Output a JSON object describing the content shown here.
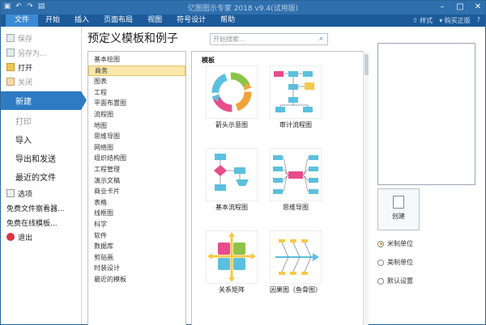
{
  "titlebar": {
    "title": "亿图图示专家 2018 v9.4(试用版)",
    "minimize": "–",
    "maximize": "□",
    "close": "✕"
  },
  "quick_access": {
    "icons": [
      "save-icon",
      "undo-icon",
      "redo-icon",
      "print-icon"
    ]
  },
  "menubar": {
    "tabs": [
      "文件",
      "开始",
      "插入",
      "页面布局",
      "视图",
      "符号设计",
      "帮助"
    ],
    "active_index": 0,
    "style_label": "样式",
    "purchase_label": "购买正版"
  },
  "sidebar": {
    "save": "保存",
    "save_as": "另存为...",
    "open": "打开",
    "close": "关闭",
    "new": "新建",
    "print": "打印",
    "import": "导入",
    "export_send": "导出和发送",
    "recent_files": "最近的文件",
    "options": "选项",
    "free_viewer": "免费文件察看器...",
    "free_templates": "免费在线模板...",
    "exit": "退出"
  },
  "main": {
    "heading": "预定义模板和例子",
    "search_placeholder": "开始搜索..."
  },
  "categories": {
    "items": [
      "基本绘图",
      "商务",
      "图表",
      "工程",
      "平面布置图",
      "流程图",
      "地图",
      "思维导图",
      "网络图",
      "组织结构图",
      "工程管理",
      "演示文稿",
      "商业卡片",
      "表格",
      "线框图",
      "科学",
      "软件",
      "数据库",
      "剪贴画",
      "时装设计",
      "最近的模板"
    ],
    "selected_index": 1
  },
  "templates": {
    "section_title": "模板",
    "items": [
      {
        "label": "箭头示意图",
        "icon": "circular-arrows-icon"
      },
      {
        "label": "审计流程图",
        "icon": "audit-flowchart-icon"
      },
      {
        "label": "基本流程图",
        "icon": "basic-flowchart-icon"
      },
      {
        "label": "思维导图",
        "icon": "mindmap-icon"
      },
      {
        "label": "关系矩阵",
        "icon": "matrix-icon"
      },
      {
        "label": "因果图（鱼骨图）",
        "icon": "fishbone-icon"
      }
    ]
  },
  "right_panel": {
    "create_label": "创建",
    "units": [
      "米制单位",
      "美制单位",
      "默认设置"
    ],
    "selected_unit": 0
  },
  "colors": {
    "accent": "#2f6fae",
    "menubar": "#1c5a9a",
    "active_blue": "#2e7bc3",
    "selection": "#fbe7a9"
  }
}
